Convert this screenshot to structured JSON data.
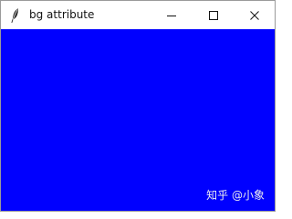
{
  "window": {
    "title": "bg attribute",
    "icon": "feather-icon",
    "controls": {
      "minimize_icon": "minimize-icon",
      "maximize_icon": "maximize-icon",
      "close_icon": "close-icon"
    }
  },
  "content": {
    "background": "#0000ff"
  },
  "watermark": {
    "text": "知乎 @小象"
  }
}
